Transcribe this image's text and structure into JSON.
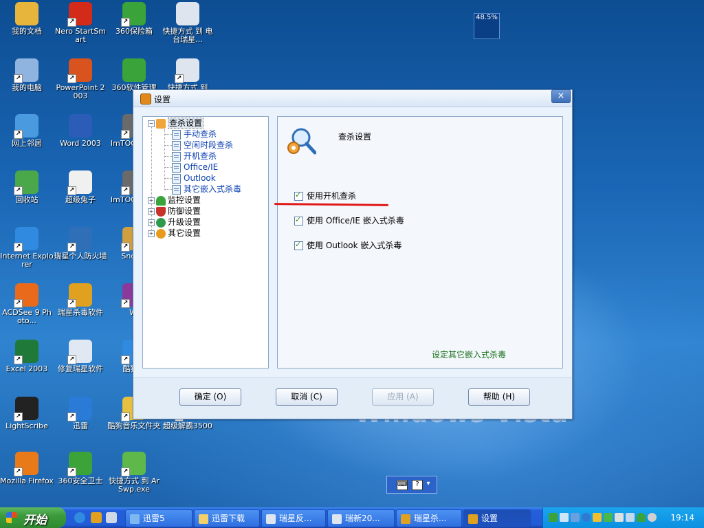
{
  "desktop": {
    "icons": [
      {
        "label": "我的文档",
        "color": "#e8b53c"
      },
      {
        "label": "Nero StartSmart",
        "color": "#d32a1a"
      },
      {
        "label": "360保险箱",
        "color": "#3aa33a"
      },
      {
        "label": "快捷方式 到 电台瑞星...",
        "color": "#dfe5ef"
      },
      {
        "label": "我的电脑",
        "color": "#8fb4e0"
      },
      {
        "label": "PowerPoint 2003",
        "color": "#d9531e"
      },
      {
        "label": "360软件管理",
        "color": "#3aa33a"
      },
      {
        "label": "快捷方式 到",
        "color": "#dfe5ef"
      },
      {
        "label": "网上邻居",
        "color": "#4a9ae0"
      },
      {
        "label": "Word 2003",
        "color": "#2b5db8"
      },
      {
        "label": "ImTOO Enco",
        "color": "#6a6a6a"
      },
      {
        "label": "回收站",
        "color": "#4aa84a"
      },
      {
        "label": "超级兔子",
        "color": "#f0f0f0"
      },
      {
        "label": "ImTOO Enco",
        "color": "#6a6a6a"
      },
      {
        "label": "Internet Explorer",
        "color": "#2f8ae0"
      },
      {
        "label": "瑞星个人防火墙",
        "color": "#2f6fb8"
      },
      {
        "label": "SndMa",
        "color": "#d0a040"
      },
      {
        "label": "ACDSee 9 Photo...",
        "color": "#e86a1a"
      },
      {
        "label": "瑞星杀毒软件",
        "color": "#e0a020"
      },
      {
        "label": "Wi",
        "color": "#8a3a9a"
      },
      {
        "label": "Excel 2003",
        "color": "#1f7a3a"
      },
      {
        "label": "修复瑞星软件",
        "color": "#e0e8f4"
      },
      {
        "label": "酷狗音",
        "color": "#2f8ae0"
      },
      {
        "label": "LightScribe",
        "color": "#222222"
      },
      {
        "label": "迅雷",
        "color": "#2a7ad8"
      },
      {
        "label": "酷狗音乐文件夹",
        "color": "#e8c040"
      },
      {
        "label": "超级解霸3500",
        "color": "#2f6fb8"
      },
      {
        "label": "Mozilla Firefox",
        "color": "#e87a1a"
      },
      {
        "label": "360安全卫士",
        "color": "#3aa33a"
      },
      {
        "label": "快捷方式 到 ArSwp.exe",
        "color": "#5fb84a"
      }
    ],
    "cpu_meter": "48.5%",
    "wallpaper_text": "Windows Vista"
  },
  "dialog": {
    "title": "设置",
    "close_label": "×",
    "tree": {
      "root": "查杀设置",
      "leaves": [
        "手动查杀",
        "空闲时段查杀",
        "开机查杀",
        "Office/IE",
        "Outlook",
        "其它嵌入式杀毒"
      ],
      "groups": [
        "监控设置",
        "防御设置",
        "升级设置",
        "其它设置"
      ]
    },
    "content": {
      "title": "查杀设置",
      "options": [
        {
          "label": "使用开机查杀",
          "checked": true
        },
        {
          "label": "使用 Office/IE 嵌入式杀毒",
          "checked": true
        },
        {
          "label": "使用 Outlook 嵌入式杀毒",
          "checked": true
        }
      ],
      "link": "设定其它嵌入式杀毒"
    },
    "buttons": {
      "ok": "确定 (O)",
      "cancel": "取消 (C)",
      "apply": "应用 (A)",
      "help": "帮助 (H)"
    }
  },
  "taskbar": {
    "start_label": "开始",
    "tasks": [
      "迅雷5",
      "迅雷下载",
      "瑞星反...",
      "瑞新20...",
      "瑞星杀...",
      "设置"
    ],
    "clock": "19:14"
  }
}
